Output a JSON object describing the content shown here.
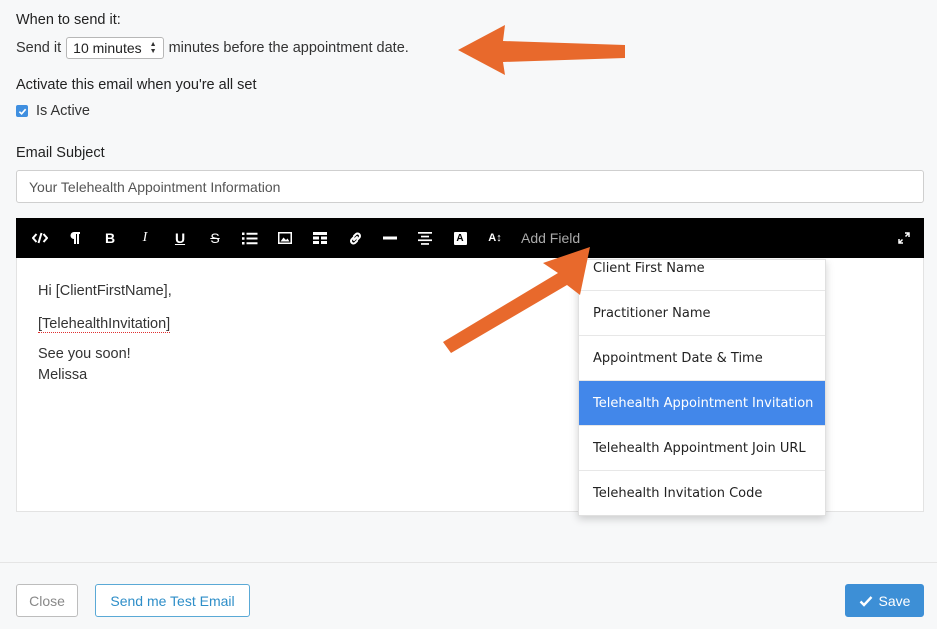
{
  "schedule": {
    "heading": "When to send it:",
    "prefix": "Send it",
    "selected_interval": "10 minutes",
    "suffix": "minutes before the appointment date."
  },
  "activation": {
    "heading": "Activate this email when you're all set",
    "checkbox_label": "Is Active",
    "checked": true
  },
  "subject": {
    "heading": "Email Subject",
    "value": "Your Telehealth Appointment Information"
  },
  "toolbar": {
    "icons": [
      "code-view-icon",
      "paragraph-icon",
      "bold-icon",
      "italic-icon",
      "underline-icon",
      "strikethrough-icon",
      "unordered-list-icon",
      "image-icon",
      "table-icon",
      "link-icon",
      "horizontal-rule-icon",
      "align-icon",
      "font-color-icon",
      "font-size-icon",
      "fullscreen-icon"
    ],
    "bold_label": "B",
    "italic_label": "I",
    "underline_label": "U",
    "strike_label": "S",
    "font_color_label": "A",
    "font_size_label": "A↕",
    "add_field_label": "Add Field"
  },
  "editor": {
    "line1": "Hi [ClientFirstName],",
    "line2": "[TelehealthInvitation]",
    "line3": "See you soon!",
    "line4": "Melissa"
  },
  "add_field_menu": {
    "items": [
      {
        "label": "Client First Name"
      },
      {
        "label": "Practitioner Name"
      },
      {
        "label": "Appointment Date & Time"
      },
      {
        "label": "Telehealth Appointment Invitation",
        "highlighted": true
      },
      {
        "label": "Telehealth Appointment Join URL"
      },
      {
        "label": "Telehealth Invitation Code"
      }
    ]
  },
  "footer": {
    "close_label": "Close",
    "test_label": "Send me Test Email",
    "save_label": "Save"
  },
  "colors": {
    "accent": "#3d8fd6",
    "highlight": "#4287ea",
    "annotation_arrow": "#e8692c"
  }
}
